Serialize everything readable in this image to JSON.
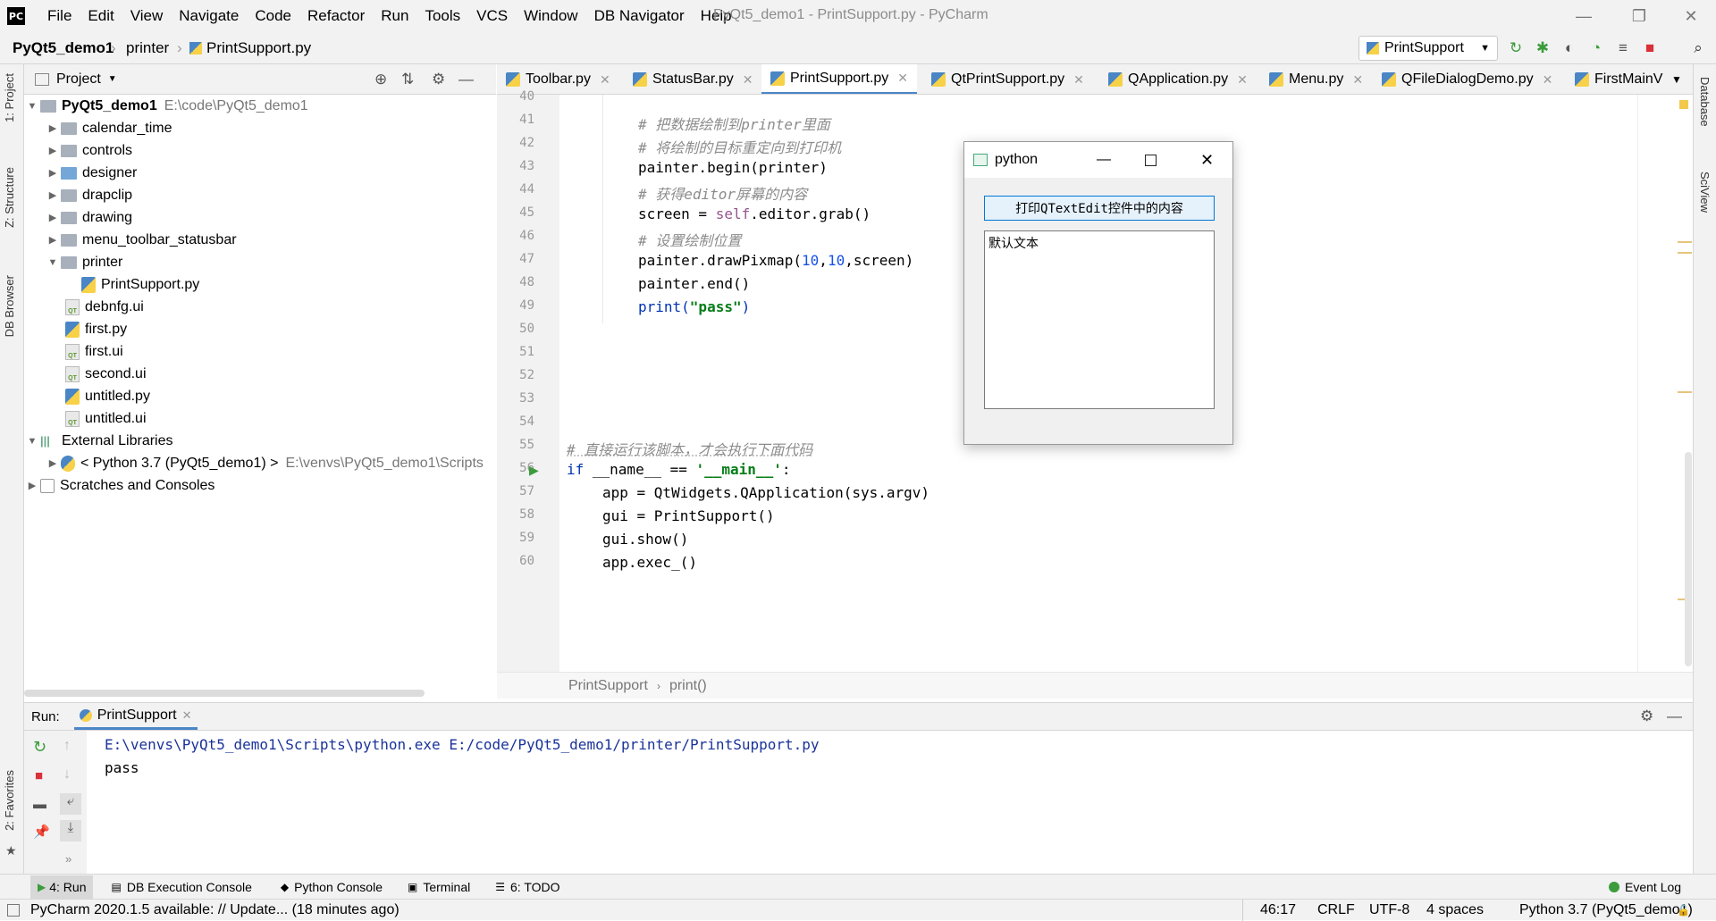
{
  "window": {
    "title": "PyQt5_demo1 - PrintSupport.py - PyCharm",
    "menu": [
      "File",
      "Edit",
      "View",
      "Navigate",
      "Code",
      "Refactor",
      "Run",
      "Tools",
      "VCS",
      "Window",
      "DB Navigator",
      "Help"
    ]
  },
  "nav": {
    "project": "PyQt5_demo1",
    "folder": "printer",
    "file": "PrintSupport.py",
    "run_config": "PrintSupport"
  },
  "left_strip": {
    "project": "1: Project",
    "structure": "Z: Structure",
    "db_browser": "DB Browser",
    "favorites": "2: Favorites"
  },
  "right_strip": {
    "database": "Database",
    "sciview": "SciView"
  },
  "project_panel": {
    "title": "Project",
    "root_name": "PyQt5_demo1",
    "root_path": "E:\\code\\PyQt5_demo1",
    "folders": [
      "calendar_time",
      "controls",
      "designer",
      "drapclip",
      "drawing",
      "menu_toolbar_statusbar",
      "printer"
    ],
    "printer_child": "PrintSupport.py",
    "files": [
      "debnfg.ui",
      "first.py",
      "first.ui",
      "second.ui",
      "untitled.py",
      "untitled.ui"
    ],
    "external": "External Libraries",
    "python_sdk": "< Python 3.7 (PyQt5_demo1) >",
    "python_sdk_path": "E:\\venvs\\PyQt5_demo1\\Scripts",
    "scratches": "Scratches and Consoles"
  },
  "tabs": [
    "Toolbar.py",
    "StatusBar.py",
    "PrintSupport.py",
    "QtPrintSupport.py",
    "QApplication.py",
    "Menu.py",
    "QFileDialogDemo.py",
    "FirstMainV"
  ],
  "editor": {
    "lines": [
      "40",
      "41",
      "42",
      "43",
      "44",
      "45",
      "46",
      "47",
      "48",
      "49",
      "50",
      "51",
      "52",
      "53",
      "54",
      "55",
      "56",
      "57",
      "58",
      "59",
      "60"
    ],
    "c41": "# 把数据绘制到printer里面",
    "c42": "# 将绘制的目标重定向到打印机",
    "l43": "painter.begin(printer)",
    "c44": "# 获得editor屏幕的内容",
    "l45a": "screen = ",
    "l45b": "self",
    "l45c": ".editor.grab()",
    "c46": "# 设置绘制位置",
    "l47a": "painter.drawPixmap(",
    "l47b": "10",
    "l47c": ",",
    "l47d": "10",
    "l47e": ",screen)",
    "l48": "painter.end()",
    "l49a": "print(",
    "l49b": "\"pass\"",
    "l49c": ")",
    "c55": "# 直接运行该脚本，才会执行下面代码",
    "l56a": "if",
    "l56b": " __name__ == ",
    "l56c": "'__main__'",
    "l56d": ":",
    "l57": "app = QtWidgets.QApplication(sys.argv)",
    "l58": "gui = PrintSupport()",
    "l59": "gui.show()",
    "l60": "app.exec_()",
    "breadcrumb_class": "PrintSupport",
    "breadcrumb_method": "print()"
  },
  "dialog": {
    "title": "python",
    "button": "打印QTextEdit控件中的内容",
    "text": "默认文本"
  },
  "run": {
    "label": "Run:",
    "tab": "PrintSupport",
    "cmd": "E:\\venvs\\PyQt5_demo1\\Scripts\\python.exe E:/code/PyQt5_demo1/printer/PrintSupport.py",
    "output": "pass"
  },
  "toolwindows": {
    "run": "4: Run",
    "db_console": "DB Execution Console",
    "python_console": "Python Console",
    "terminal": "Terminal",
    "todo": "6: TODO",
    "event_log": "Event Log"
  },
  "status": {
    "message": "PyCharm 2020.1.5 available: // Update... (18 minutes ago)",
    "position": "46:17",
    "line_sep": "CRLF",
    "encoding": "UTF-8",
    "indent": "4 spaces",
    "interpreter": "Python 3.7 (PyQt5_demo1)"
  },
  "colors": {
    "accent": "#4a86c8",
    "keyword": "#0033b3",
    "string": "#067d17",
    "comment": "#8c8c8c"
  }
}
